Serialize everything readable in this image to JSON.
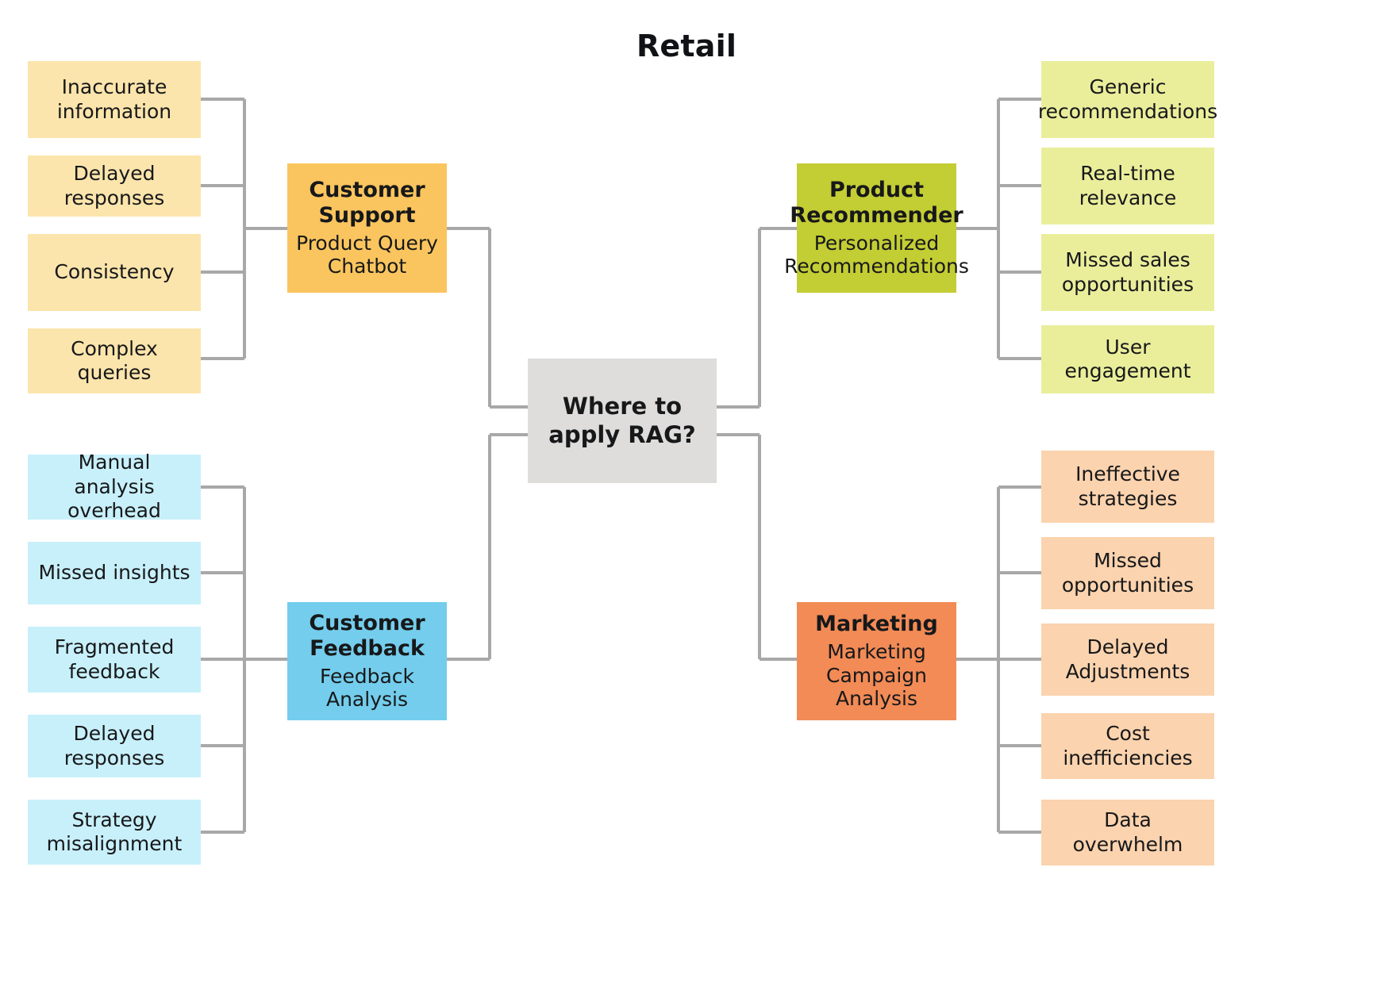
{
  "title": "Retail",
  "center": {
    "label_line1": "Where to",
    "label_line2": "apply RAG?",
    "color": "#dedddb"
  },
  "colors": {
    "connector": "#a8a8a8",
    "branch_customer_support": "#fac55e",
    "leaf_customer_support": "#fce5ac",
    "branch_customer_feedback": "#74cdec",
    "leaf_customer_feedback": "#c8f0fa",
    "branch_product_recommender": "#c3cd34",
    "leaf_product_recommender": "#eaee9b",
    "branch_marketing": "#f28b56",
    "leaf_marketing": "#fbd3ae"
  },
  "branches": [
    {
      "id": "customer-support",
      "title": "Customer Support",
      "title_line1": "Customer",
      "title_line2": "Support",
      "subtitle_line1": "Product Query",
      "subtitle_line2": "Chatbot",
      "leaves": [
        {
          "line1": "Inaccurate",
          "line2": "information"
        },
        {
          "line1": "Delayed responses",
          "line2": ""
        },
        {
          "line1": "Consistency",
          "line2": ""
        },
        {
          "line1": "Complex queries",
          "line2": ""
        }
      ]
    },
    {
      "id": "customer-feedback",
      "title": "Customer Feedback",
      "title_line1": "Customer",
      "title_line2": "Feedback",
      "subtitle_line1": "Feedback",
      "subtitle_line2": "Analysis",
      "leaves": [
        {
          "line1": "Manual analysis",
          "line2": "overhead"
        },
        {
          "line1": "Missed insights",
          "line2": ""
        },
        {
          "line1": "Fragmented",
          "line2": "feedback"
        },
        {
          "line1": "Delayed responses",
          "line2": ""
        },
        {
          "line1": "Strategy",
          "line2": "misalignment"
        }
      ]
    },
    {
      "id": "product-recommender",
      "title": "Product Recommender",
      "title_line1": "Product",
      "title_line2": "Recommender",
      "subtitle_line1": "Personalized",
      "subtitle_line2": "Recommendations",
      "leaves": [
        {
          "line1": "Generic",
          "line2": "recommendations"
        },
        {
          "line1": "Real-time",
          "line2": "relevance"
        },
        {
          "line1": "Missed sales",
          "line2": "opportunities"
        },
        {
          "line1": "User engagement",
          "line2": ""
        }
      ]
    },
    {
      "id": "marketing",
      "title": "Marketing",
      "title_line1": "Marketing",
      "title_line2": "",
      "subtitle_line1": "Marketing",
      "subtitle_line2": "Campaign",
      "subtitle_line3": "Analysis",
      "leaves": [
        {
          "line1": "Ineffective",
          "line2": "strategies"
        },
        {
          "line1": "Missed",
          "line2": "opportunities"
        },
        {
          "line1": "Delayed",
          "line2": "Adjustments"
        },
        {
          "line1": "Cost inefficiencies",
          "line2": ""
        },
        {
          "line1": "Data overwhelm",
          "line2": ""
        }
      ]
    }
  ]
}
